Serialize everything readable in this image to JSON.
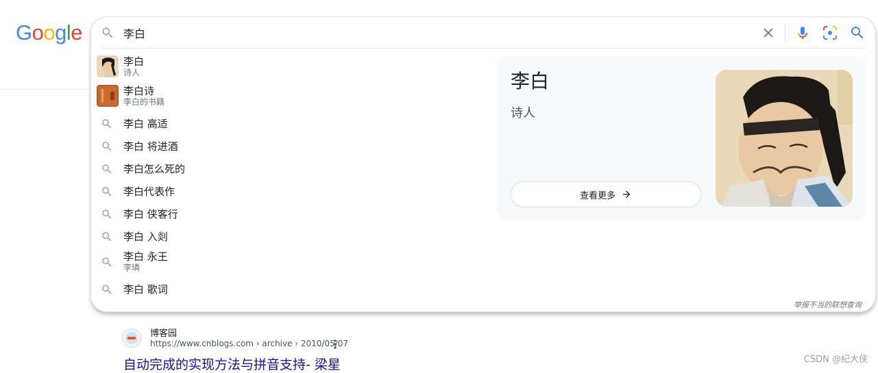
{
  "logo": {
    "text": "Google",
    "letters": [
      {
        "ch": "G",
        "color": "#4285F4"
      },
      {
        "ch": "o",
        "color": "#EA4335"
      },
      {
        "ch": "o",
        "color": "#FBBC05"
      },
      {
        "ch": "g",
        "color": "#4285F4"
      },
      {
        "ch": "l",
        "color": "#34A853"
      },
      {
        "ch": "e",
        "color": "#EA4335"
      }
    ]
  },
  "search": {
    "value": "李白",
    "placeholder": ""
  },
  "suggestions": [
    {
      "main": "李白",
      "sub": "诗人",
      "kind": "person-thumb"
    },
    {
      "main": "李白诗",
      "sub": "李白的书籍",
      "kind": "book-thumb"
    },
    {
      "main": "李白 高适",
      "sub": "",
      "kind": "search"
    },
    {
      "main": "李白 将进酒",
      "sub": "",
      "kind": "search"
    },
    {
      "main": "李白怎么死的",
      "sub": "",
      "kind": "search"
    },
    {
      "main": "李白代表作",
      "sub": "",
      "kind": "search"
    },
    {
      "main": "李白 侠客行",
      "sub": "",
      "kind": "search"
    },
    {
      "main": "李白 入剡",
      "sub": "",
      "kind": "search"
    },
    {
      "main": "李白 永王",
      "sub": "李璘",
      "kind": "search"
    },
    {
      "main": "李白 歌词",
      "sub": "",
      "kind": "search"
    }
  ],
  "knowledge_card": {
    "title": "李白",
    "subtitle": "诗人",
    "more_label": "查看更多"
  },
  "report_label": "举报不当的联想查询",
  "result": {
    "site_name": "博客园",
    "url": "https://www.cnblogs.com › archive › 2010/05/07",
    "title": "自动完成的实现方法与拼音支持- 梁星"
  },
  "watermark": "CSDN @纪大侠",
  "colors": {
    "link": "#1a0dab",
    "accent_blue": "#4285F4"
  }
}
